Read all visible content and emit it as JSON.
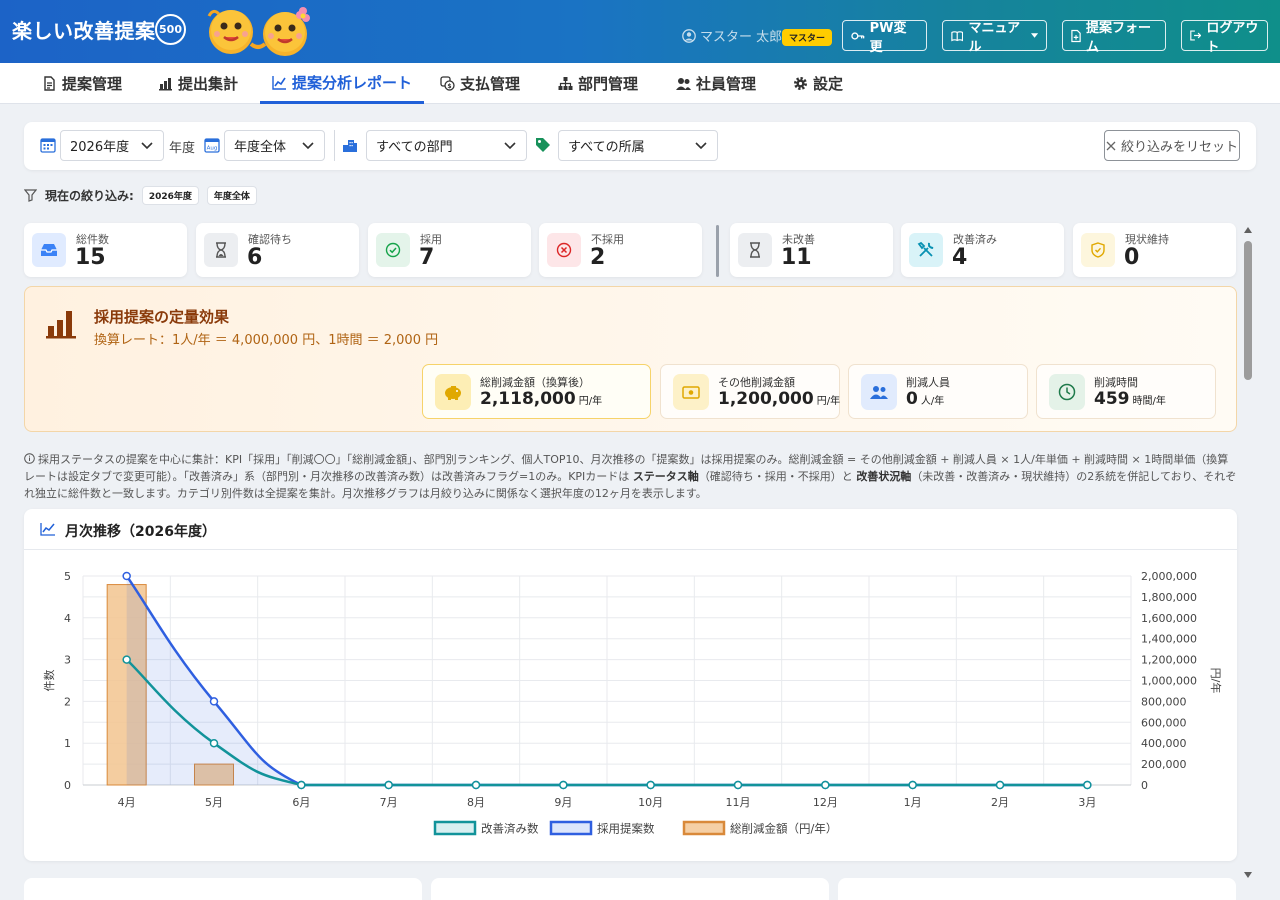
{
  "header": {
    "brand": "楽しい改善提案",
    "badge": "500",
    "user_name": "マスター 太郎",
    "role_badge": "マスター",
    "buttons": {
      "pw": "PW変更",
      "manual": "マニュアル",
      "form": "提案フォーム",
      "logout": "ログアウト"
    }
  },
  "nav": {
    "tabs": [
      {
        "label": "提案管理",
        "icon": "document-icon"
      },
      {
        "label": "提出集計",
        "icon": "bar-chart-icon"
      },
      {
        "label": "提案分析レポート",
        "icon": "trend-chart-icon",
        "active": true
      },
      {
        "label": "支払管理",
        "icon": "coin-icon"
      },
      {
        "label": "部門管理",
        "icon": "org-chart-icon"
      },
      {
        "label": "社員管理",
        "icon": "users-icon"
      },
      {
        "label": "設定",
        "icon": "gear-icon"
      }
    ]
  },
  "filters": {
    "year_value": "2026年度",
    "year_suffix": "年度",
    "period_value": "年度全体",
    "department_value": "すべての部門",
    "affiliation_value": "すべての所属",
    "reset_label": "絞り込みをリセット"
  },
  "current_filter": {
    "label": "現在の絞り込み:",
    "chips": [
      "2026年度",
      "年度全体"
    ]
  },
  "kpis": [
    {
      "label": "総件数",
      "value": "15",
      "icon": "inbox-icon",
      "color": "#3b82f6"
    },
    {
      "label": "確認待ち",
      "value": "6",
      "icon": "hourglass-icon",
      "color": "#6b7280"
    },
    {
      "label": "採用",
      "value": "7",
      "icon": "check-circle-icon",
      "color": "#16a34a"
    },
    {
      "label": "不採用",
      "value": "2",
      "icon": "x-circle-icon",
      "color": "#dc2626"
    },
    {
      "label": "未改善",
      "value": "11",
      "icon": "hourglass-icon",
      "color": "#6b7280"
    },
    {
      "label": "改善済み",
      "value": "4",
      "icon": "tools-icon",
      "color": "#0891b2"
    },
    {
      "label": "現状維持",
      "value": "0",
      "icon": "shield-icon",
      "color": "#eab308"
    }
  ],
  "effect": {
    "title": "採用提案の定量効果",
    "rate": "換算レート：1人/年 ＝ 4,000,000 円、1時間 ＝ 2,000 円",
    "cards": [
      {
        "label": "総削減金額（換算後）",
        "value": "2,118,000",
        "unit": "円/年",
        "icon": "piggy-bank-icon"
      },
      {
        "label": "その他削減金額",
        "value": "1,200,000",
        "unit": "円/年",
        "icon": "money-icon"
      },
      {
        "label": "削減人員",
        "value": "0",
        "unit": "人/年",
        "icon": "people-icon"
      },
      {
        "label": "削減時間",
        "value": "459",
        "unit": "時間/年",
        "icon": "clock-icon"
      }
    ]
  },
  "note": {
    "p1": "採用ステータスの提案を中心に集計：KPI「採用」「削減〇〇」「総削減金額」、部門別ランキング、個人TOP10、月次推移の「提案数」は採用提案のみ。総削減金額 = その他削減金額 + 削減人員 × 1人/年単価 + 削減時間 × 1時間単価（換算レートは設定タブで変更可能）。「改善済み」系（部門別・月次推移の改善済み数）は改善済みフラグ=1のみ。KPIカードは ",
    "b1": "ステータス軸",
    "p2": "（確認待ち・採用・不採用）と ",
    "b2": "改善状況軸",
    "p3": "（未改善・改善済み・現状維持）の2系統を併記しており、それぞれ独立に総件数と一致します。カテゴリ別件数は全提案を集計。月次推移グラフは月絞り込みに関係なく選択年度の12ヶ月を表示します。"
  },
  "chart_panel": {
    "title": "月次推移（2026年度）"
  },
  "chart_data": {
    "type": "line",
    "categories": [
      "4月",
      "5月",
      "6月",
      "7月",
      "8月",
      "9月",
      "10月",
      "11月",
      "12月",
      "1月",
      "2月",
      "3月"
    ],
    "series": [
      {
        "name": "改善済み数",
        "type": "line",
        "axis": "left",
        "values": [
          3,
          1,
          0,
          0,
          0,
          0,
          0,
          0,
          0,
          0,
          0,
          0
        ],
        "color": "#12939a"
      },
      {
        "name": "採用提案数",
        "type": "area",
        "axis": "left",
        "values": [
          5,
          2,
          0,
          0,
          0,
          0,
          0,
          0,
          0,
          0,
          0,
          0
        ],
        "color": "#2f5fe0"
      },
      {
        "name": "総削減金額（円/年）",
        "type": "bar",
        "axis": "right",
        "values": [
          1918000,
          200000,
          0,
          0,
          0,
          0,
          0,
          0,
          0,
          0,
          0,
          0
        ],
        "color": "#f2c48f"
      }
    ],
    "ylabel": "件数",
    "y2label": "円/年",
    "ylim": [
      0,
      5
    ],
    "y2lim": [
      0,
      2000000
    ],
    "yticks": [
      "0",
      "1",
      "2",
      "3",
      "4",
      "5"
    ],
    "y2ticks": [
      "0",
      "200,000",
      "400,000",
      "600,000",
      "800,000",
      "1,000,000",
      "1,200,000",
      "1,400,000",
      "1,600,000",
      "1,800,000",
      "2,000,000"
    ],
    "grid": true,
    "legend": "bottom"
  }
}
